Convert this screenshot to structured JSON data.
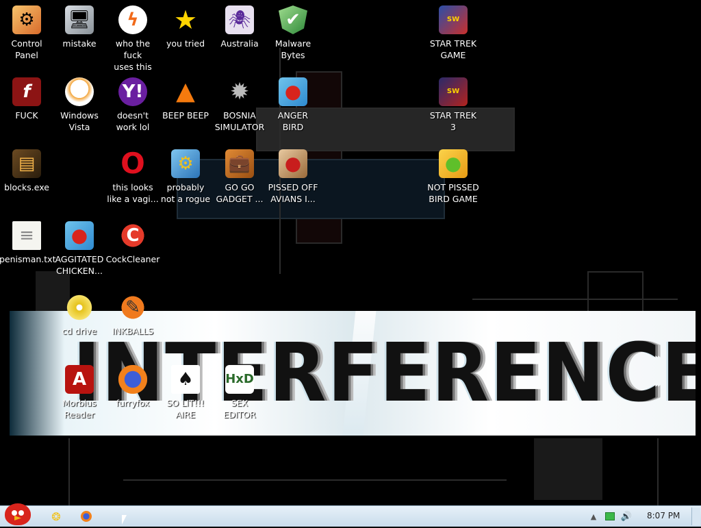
{
  "desktop": {
    "icons": [
      {
        "label": "Control\nPanel",
        "icon": "control-panel-icon"
      },
      {
        "label": "mistake",
        "icon": "computer-icon"
      },
      {
        "label": "who the fuck\nuses this",
        "icon": "avast-icon"
      },
      {
        "label": "you tried",
        "icon": "star-icon"
      },
      {
        "label": "Australia",
        "icon": "spider-icon"
      },
      {
        "label": "Malware\nBytes",
        "icon": "shield-icon"
      },
      {
        "label": "STAR TREK\nGAME",
        "icon": "star-wars-icon"
      },
      {
        "label": "FUCK",
        "icon": "flash-icon"
      },
      {
        "label": "Windows\nVista",
        "icon": "egg-icon"
      },
      {
        "label": "doesn't\nwork lol",
        "icon": "yahoo-messenger-icon"
      },
      {
        "label": "BEEP BEEP",
        "icon": "vlc-icon"
      },
      {
        "label": "BOSNIA\nSIMULATOR",
        "icon": "mine-icon"
      },
      {
        "label": "ANGER\nBIRD",
        "icon": "angry-bird-icon"
      },
      {
        "label": "STAR TREK\n3",
        "icon": "star-wars-icon"
      },
      {
        "label": "blocks.exe",
        "icon": "blocks-icon"
      },
      {
        "label": "this looks\nlike a vagi...",
        "icon": "opera-icon"
      },
      {
        "label": "probably\nnot a rogue",
        "icon": "monitor-gear-icon"
      },
      {
        "label": "GO GO\nGADGET ...",
        "icon": "briefcase-icon"
      },
      {
        "label": "PISSED OFF\nAVIANS I...",
        "icon": "angry-birds-seasons-icon"
      },
      {
        "label": "NOT PISSED\nBIRD GAME",
        "icon": "bad-piggies-icon"
      },
      {
        "label": "penisman.txt",
        "icon": "text-file-icon"
      },
      {
        "label": "AGGITATED\nCHICKEN...",
        "icon": "angry-bird-icon"
      },
      {
        "label": "CockCleaner",
        "icon": "ccleaner-icon"
      },
      {
        "label": "cd drive",
        "icon": "cd-icon"
      },
      {
        "label": "INKBALLS",
        "icon": "inkball-icon"
      },
      {
        "label": "Morbius\nReader",
        "icon": "pdf-icon"
      },
      {
        "label": "furryfox",
        "icon": "firefox-icon"
      },
      {
        "label": "SO LIT!!!\nAIRE",
        "icon": "solitaire-icon"
      },
      {
        "label": "SEX\nEDITOR",
        "icon": "hex-editor-icon"
      }
    ]
  },
  "wallpaper": {
    "banner_text": "INTERFERENCE"
  },
  "taskbar": {
    "start_icon": "angry-bird-icon",
    "pinned": [
      {
        "icon": "folder-icon"
      },
      {
        "icon": "firefox-icon"
      }
    ],
    "tray": [
      "show-hidden-icon",
      "network-icon",
      "volume-icon"
    ],
    "clock": "8:07 PM"
  },
  "colors": {
    "desktop_bg": "#000000",
    "taskbar_bg": "#c9dcec",
    "label_text": "#ffffff"
  }
}
